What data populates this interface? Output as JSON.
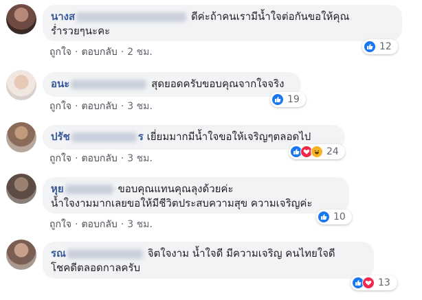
{
  "comments": [
    {
      "name": "นางส",
      "text_line1": "ดีค่ะถ้าคนเรามีน้ำใจต่อกันขอให้คุณ",
      "text_line2": "ร่ำรวยๆนะคะ",
      "like_label": "ถูกใจ",
      "reply_label": "ตอบกลับ",
      "time": "2 ชม.",
      "reaction_count": "12",
      "reactions": [
        "like"
      ]
    },
    {
      "name": "อนะ",
      "text_line1": "สุดยอดครับขอบคุณจากใจจริง",
      "like_label": "ถูกใจ",
      "reply_label": "ตอบกลับ",
      "time": "3 ชม.",
      "reaction_count": "19",
      "reactions": [
        "like"
      ]
    },
    {
      "name": "ปรัช",
      "name_tail": "ร",
      "text_line1": "เยี่ยมมากมีน้ำใจขอให้เจริญๆตลอดไป",
      "like_label": "ถูกใจ",
      "reply_label": "ตอบกลับ",
      "time": "3 ชม.",
      "reaction_count": "24",
      "reactions": [
        "like",
        "love",
        "haha"
      ]
    },
    {
      "name": "หุย",
      "text_line1": "ขอบคุณแทนคุณลุงด้วยค่ะ",
      "text_line2": "น้ำใจงามมากเลยขอให้มีชีวิตประสบความสุข ความเจริญค่ะ",
      "like_label": "ถูกใจ",
      "reply_label": "ตอบกลับ",
      "time": "3 ชม.",
      "reaction_count": "10",
      "reactions": [
        "like"
      ]
    },
    {
      "name": "รณ",
      "text_line1": "จิตใจงาม น้ำใจดี มีความเจริญ คนไทยใจดี",
      "text_line2": "โชคดีตลอดกาลครับ",
      "like_label": "ถูกใจ",
      "reply_label": "ตอบกลับ",
      "time": "3 ชม.",
      "reaction_count": "13",
      "reactions": [
        "like",
        "love"
      ]
    }
  ],
  "colors": {
    "name": "#385898",
    "bubble": "#f2f3f5",
    "like": "#1877f2",
    "love": "#f0284a",
    "haha": "#f7b125"
  }
}
